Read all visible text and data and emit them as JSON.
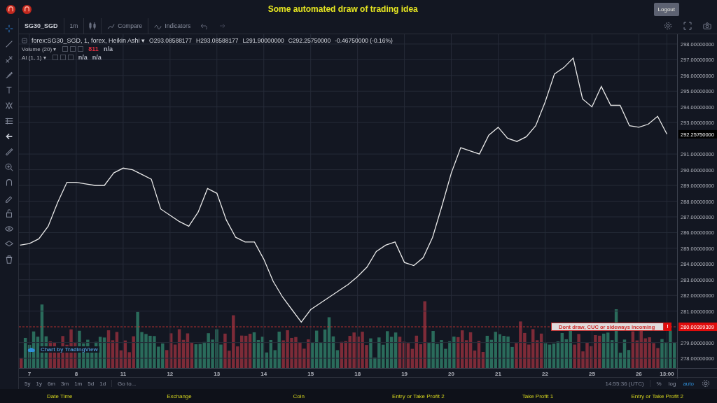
{
  "header": {
    "title": "Some automated draw of trading idea",
    "logout": "Logout"
  },
  "toolbar": {
    "symbol": "SG30_SGD",
    "interval": "1m",
    "compare": "Compare",
    "indicators": "Indicators"
  },
  "legend": {
    "series": "forex:SG30_SGD, 1, forex, Heikin Ashi ▾",
    "open": "O293.08588177",
    "high": "H293.08588177",
    "low": "L291.90000000",
    "close": "C292.25750000",
    "change": "-0.46750000 (-0.16%)",
    "studies": [
      {
        "name": "Volume (20) ▾",
        "values": [
          {
            "text": "811",
            "color": "#e03040"
          },
          {
            "text": "n/a",
            "color": "#b0b4c0"
          }
        ]
      },
      {
        "name": "AI (1, 1) ▾",
        "values": [
          {
            "text": "n/a",
            "color": "#b0b4c0"
          },
          {
            "text": "n/a",
            "color": "#b0b4c0"
          }
        ]
      }
    ]
  },
  "chart": {
    "watermark": "Chart by TradingView",
    "last_price": "292.25750000",
    "alert": {
      "price": "280.00399309",
      "message": "Dont draw, CUC or sideways incoming",
      "mark": "!"
    },
    "chart_data": {
      "type": "line",
      "grid": true,
      "ylim": [
        277.38,
        298.62
      ],
      "ref_lines": [
        {
          "axis": "y",
          "value": 280.00399309,
          "color": "#c03030"
        }
      ],
      "yticks": [
        {
          "value": 278,
          "label": "278.00000000"
        },
        {
          "value": 279,
          "label": "279.00000000"
        },
        {
          "value": 281,
          "label": "281.00000000"
        },
        {
          "value": 282,
          "label": "282.00000000"
        },
        {
          "value": 283,
          "label": "283.00000000"
        },
        {
          "value": 284,
          "label": "284.00000000"
        },
        {
          "value": 285,
          "label": "285.00000000"
        },
        {
          "value": 286,
          "label": "286.00000000"
        },
        {
          "value": 287,
          "label": "287.00000000"
        },
        {
          "value": 288,
          "label": "288.00000000"
        },
        {
          "value": 289,
          "label": "289.00000000"
        },
        {
          "value": 290,
          "label": "290.00000000"
        },
        {
          "value": 291,
          "label": "291.00000000"
        },
        {
          "value": 293,
          "label": "293.00000000"
        },
        {
          "value": 294,
          "label": "294.00000000"
        },
        {
          "value": 295,
          "label": "295.00000000"
        },
        {
          "value": 296,
          "label": "296.00000000"
        },
        {
          "value": 297,
          "label": "297.00000000"
        },
        {
          "value": 298,
          "label": "298.00000000"
        }
      ],
      "categories": [
        null,
        "7",
        null,
        null,
        null,
        null,
        "8",
        null,
        null,
        null,
        null,
        "11",
        null,
        null,
        null,
        null,
        "12",
        null,
        null,
        null,
        null,
        "13",
        null,
        null,
        null,
        null,
        "14",
        null,
        null,
        null,
        null,
        "15",
        null,
        null,
        null,
        null,
        "18",
        null,
        null,
        null,
        null,
        "19",
        null,
        null,
        null,
        null,
        "20",
        null,
        null,
        null,
        null,
        "21",
        null,
        null,
        null,
        null,
        "22",
        null,
        null,
        null,
        null,
        "25",
        null,
        null,
        null,
        null,
        "26",
        null,
        null,
        "13:00"
      ],
      "series": [
        {
          "color": "#e8e8e8",
          "values": [
            285.2,
            285.3,
            285.6,
            286.4,
            287.9,
            289.2,
            289.2,
            289.1,
            289.0,
            289.0,
            289.8,
            290.1,
            290.0,
            289.7,
            289.4,
            287.5,
            287.1,
            286.7,
            286.4,
            287.3,
            288.8,
            288.5,
            286.8,
            285.7,
            285.4,
            285.4,
            284.3,
            282.9,
            281.9,
            281.1,
            280.3,
            281.1,
            281.5,
            281.9,
            282.3,
            282.7,
            283.2,
            283.8,
            284.8,
            285.2,
            285.4,
            284.1,
            283.9,
            284.4,
            285.7,
            287.7,
            289.8,
            291.4,
            291.2,
            291.0,
            292.2,
            292.7,
            292.0,
            291.8,
            292.1,
            292.8,
            294.3,
            296.1,
            296.5,
            297.1,
            294.5,
            294.0,
            295.3,
            294.1,
            294.1,
            292.8,
            292.7,
            292.9,
            293.4,
            292.26
          ]
        }
      ]
    }
  },
  "ranges": [
    {
      "label": "5y"
    },
    {
      "label": "1y"
    },
    {
      "label": "6m"
    },
    {
      "label": "3m"
    },
    {
      "label": "1m"
    },
    {
      "label": "5d"
    },
    {
      "label": "1d"
    }
  ],
  "goto": "Go to...",
  "bottom_right": {
    "time": "14:55:36 (UTC)",
    "options": [
      {
        "label": "%",
        "selected": false
      },
      {
        "label": "log",
        "selected": false
      },
      {
        "label": "auto",
        "selected": true
      }
    ]
  },
  "footer": [
    "Date Time",
    "Exchange",
    "Coin",
    "Entry or Take Profit 2",
    "Take Profit 1",
    "Entry or Take Profit 2"
  ]
}
